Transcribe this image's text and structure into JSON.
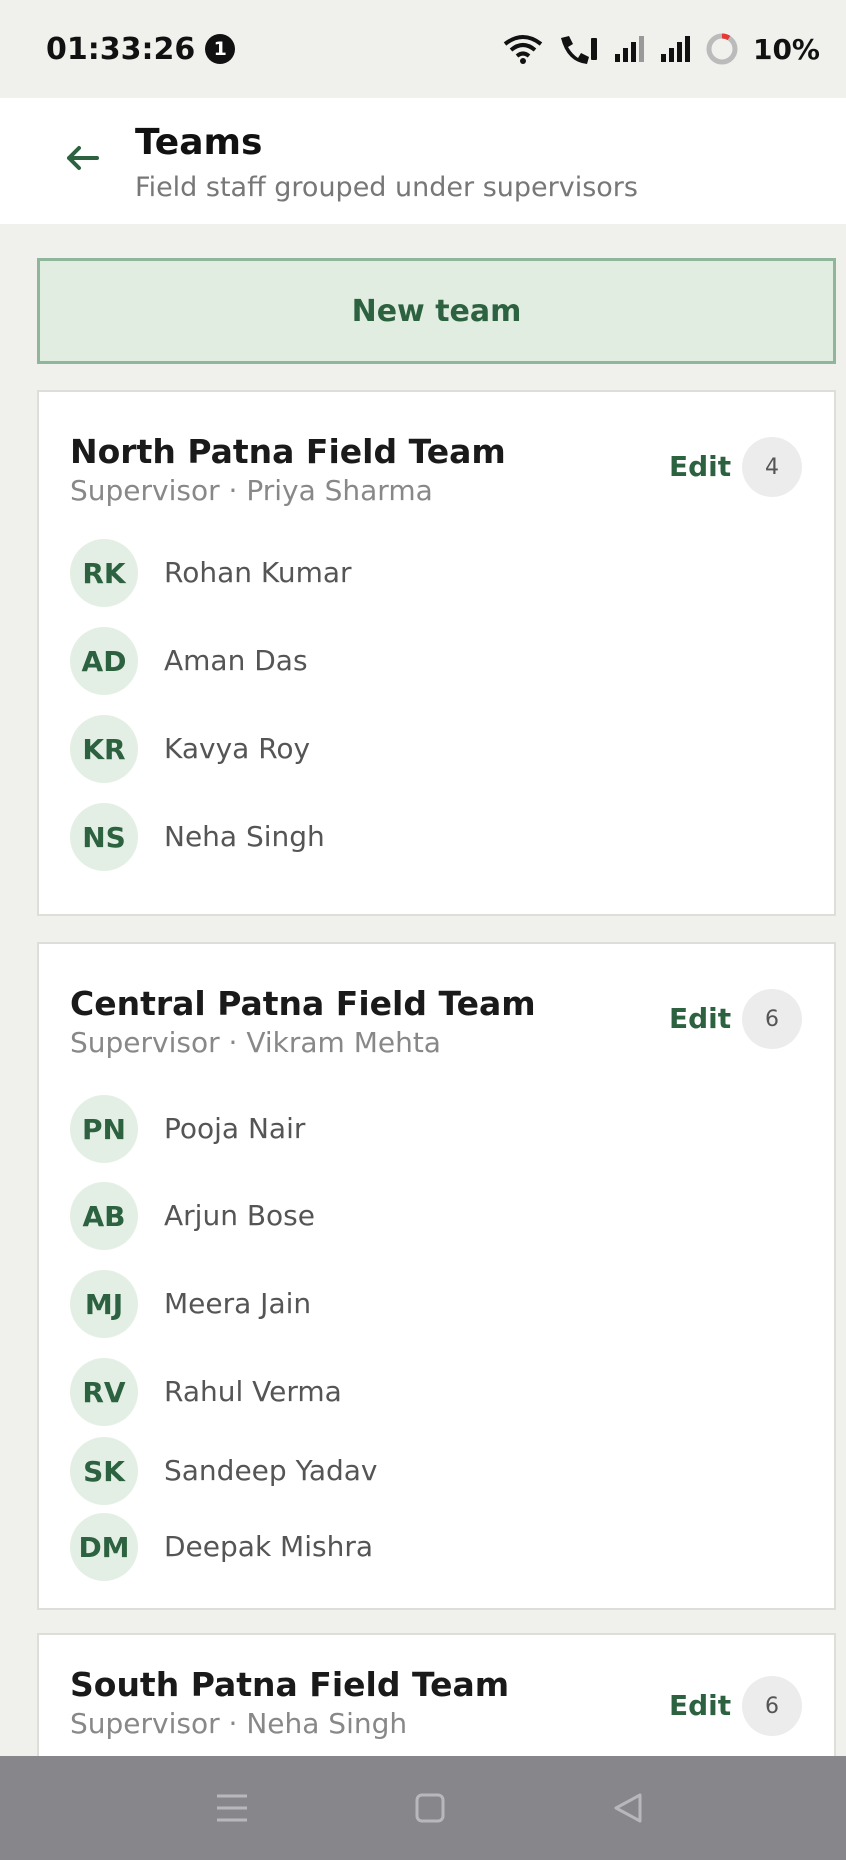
{
  "status_bar": {
    "time": "01:33:26",
    "notification_count": "1",
    "battery": "10%"
  },
  "header": {
    "title": "Teams",
    "subtitle": "Field staff grouped under supervisors"
  },
  "actions": {
    "new_team_label": "New team"
  },
  "colors": {
    "accent": "#2d6240",
    "button_bg": "#e2ede2",
    "avatar_bg": "#e3efe4",
    "page_bg": "#f0f0ec"
  },
  "teams": [
    {
      "name": "North Patna Field Team",
      "supervisor": "Supervisor · Priya Sharma",
      "edit_label": "Edit",
      "count": "4",
      "members": [
        {
          "initials": "RK",
          "name": "Rohan Kumar"
        },
        {
          "initials": "AD",
          "name": "Aman Das"
        },
        {
          "initials": "KR",
          "name": "Kavya Roy"
        },
        {
          "initials": "NS",
          "name": "Neha Singh"
        }
      ]
    },
    {
      "name": "Central Patna Field Team",
      "supervisor": "Supervisor · Vikram Mehta",
      "edit_label": "Edit",
      "count": "6",
      "members": [
        {
          "initials": "PN",
          "name": "Pooja Nair"
        },
        {
          "initials": "AB",
          "name": "Arjun Bose"
        },
        {
          "initials": "MJ",
          "name": "Meera Jain"
        },
        {
          "initials": "RV",
          "name": "Rahul Verma"
        },
        {
          "initials": "SK",
          "name": "Sandeep Yadav"
        },
        {
          "initials": "DM",
          "name": "Deepak Mishra"
        }
      ]
    },
    {
      "name": "South Patna Field Team",
      "supervisor": "Supervisor · Neha Singh",
      "edit_label": "Edit",
      "count": "6",
      "members": []
    }
  ]
}
